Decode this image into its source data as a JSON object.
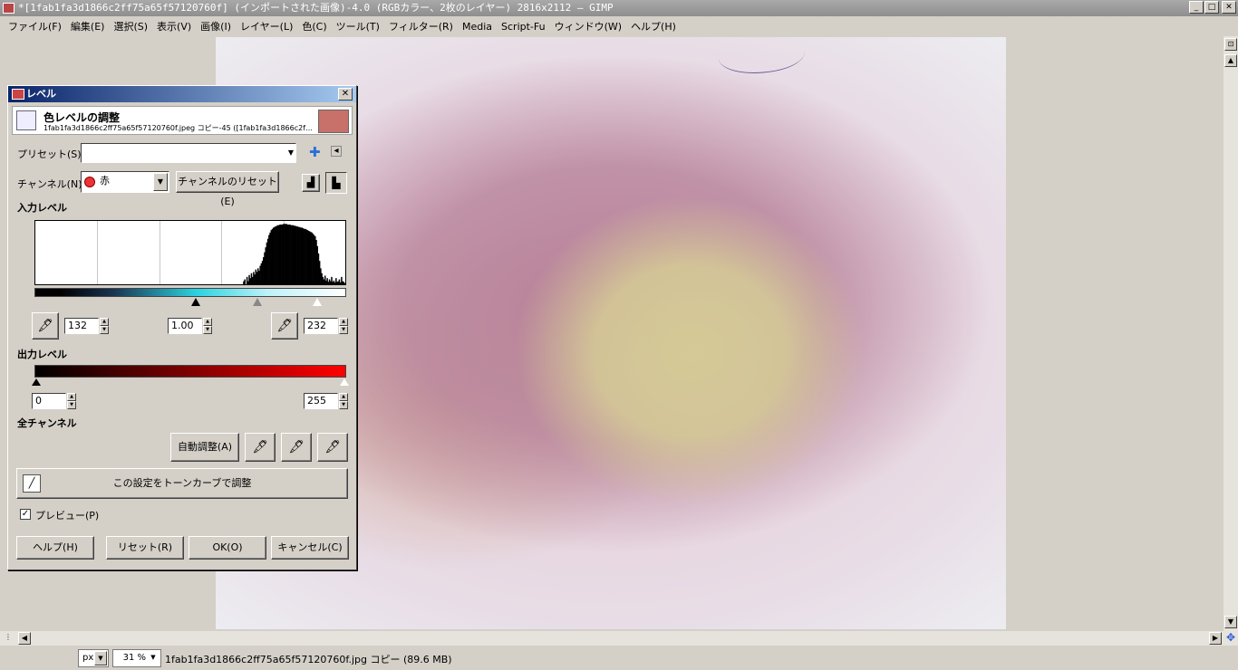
{
  "window": {
    "title": "*[1fab1fa3d1866c2ff75a65f57120760f] (インポートされた画像)-4.0 (RGBカラー、2枚のレイヤー) 2816x2112 – GIMP",
    "minimize": "_",
    "maximize": "□",
    "close": "✕"
  },
  "menu": [
    "ファイル(F)",
    "編集(E)",
    "選択(S)",
    "表示(V)",
    "画像(I)",
    "レイヤー(L)",
    "色(C)",
    "ツール(T)",
    "フィルター(R)",
    "Media",
    "Script-Fu",
    "ウィンドウ(W)",
    "ヘルプ(H)"
  ],
  "dialog": {
    "title": "レベル",
    "close": "✕",
    "header_title": "色レベルの調整",
    "header_sub": "1fab1fa3d1866c2ff75a65f57120760f.jpeg コピー-45 ([1fab1fa3d1866c2f…",
    "preset_label": "プリセット(S):",
    "preset_value": "",
    "channel_label": "チャンネル(N):",
    "channel_value": "赤",
    "channel_reset": "チャンネルのリセット(E)",
    "input_levels": "入力レベル",
    "input_low": "132",
    "input_gamma": "1.00",
    "input_high": "232",
    "output_levels": "出力レベル",
    "output_low": "0",
    "output_high": "255",
    "all_channels": "全チャンネル",
    "auto": "自動調整(A)",
    "curves": "この設定をトーンカーブで調整",
    "preview": "プレビュー(P)",
    "help": "ヘルプ(H)",
    "reset": "リセット(R)",
    "ok": "OK(O)",
    "cancel": "キャンセル(C)",
    "colors": {
      "channel_red": "#ff0000"
    }
  },
  "histogram": [
    0,
    0,
    0,
    0,
    0,
    0,
    0,
    0,
    0,
    0,
    0,
    0,
    0,
    0,
    0,
    0,
    0,
    0,
    0,
    0,
    0,
    0,
    0,
    0,
    0,
    0,
    0,
    0,
    0,
    0,
    0,
    0,
    0,
    0,
    0,
    0,
    0,
    0,
    0,
    0,
    0,
    0,
    0,
    0,
    0,
    0,
    0,
    0,
    0,
    0,
    0,
    0,
    0,
    0,
    0,
    0,
    0,
    0,
    0,
    0,
    0,
    0,
    0,
    0,
    0,
    0,
    0,
    0,
    0,
    0,
    0,
    0,
    0,
    0,
    0,
    0,
    0,
    0,
    0,
    0,
    0,
    0,
    0,
    0,
    0,
    0,
    0,
    0,
    0,
    0,
    0,
    0,
    0,
    0,
    0,
    0,
    0,
    0,
    0,
    0,
    0,
    0,
    0,
    0,
    0,
    0,
    0,
    0,
    0,
    0,
    0,
    0,
    0,
    0,
    0,
    0,
    0,
    0,
    0,
    0,
    0,
    0,
    0,
    0,
    0,
    0,
    0,
    0,
    0,
    0,
    0,
    0,
    0,
    0,
    0,
    0,
    0,
    0,
    0,
    0,
    0,
    0,
    0,
    0,
    0,
    0,
    0,
    0,
    0,
    0,
    0,
    0,
    0,
    0,
    0,
    0,
    0,
    0,
    0,
    0,
    0,
    0,
    0,
    0,
    0,
    0,
    0,
    0,
    0,
    0,
    0,
    0,
    0,
    0,
    0,
    0,
    0,
    0,
    0,
    0,
    0,
    0,
    0,
    0,
    0,
    0,
    0,
    0,
    0,
    0.05,
    0.08,
    0,
    0.12,
    0.05,
    0.15,
    0.1,
    0.18,
    0.12,
    0.2,
    0.16,
    0.24,
    0.2,
    0.26,
    0.22,
    0.3,
    0.34,
    0.38,
    0.44,
    0.52,
    0.6,
    0.68,
    0.74,
    0.8,
    0.84,
    0.88,
    0.9,
    0.92,
    0.93,
    0.94,
    0.95,
    0.96,
    0.96,
    0.97,
    0.97,
    0.97,
    0.98,
    0.98,
    0.98,
    0.98,
    0.97,
    0.97,
    0.97,
    0.96,
    0.96,
    0.96,
    0.95,
    0.95,
    0.94,
    0.94,
    0.93,
    0.93,
    0.92,
    0.92,
    0.91,
    0.9,
    0.9,
    0.89,
    0.88,
    0.87,
    0.86,
    0.85,
    0.84,
    0.82,
    0.8,
    0.78,
    0.72,
    0.62,
    0.5,
    0.38,
    0.26,
    0.18,
    0.12,
    0.08,
    0.14,
    0.06,
    0.1,
    0.04,
    0.08,
    0.05,
    0.12,
    0.04,
    0.06,
    0.03,
    0.1,
    0.04,
    0.05,
    0.08,
    0.03,
    0.12,
    0.05,
    0.04,
    0.02
  ],
  "status": {
    "unit": "px",
    "zoom": "31 %",
    "info": "1fab1fa3d1866c2ff75a65f57120760f.jpg コピー (89.6 MB)"
  }
}
